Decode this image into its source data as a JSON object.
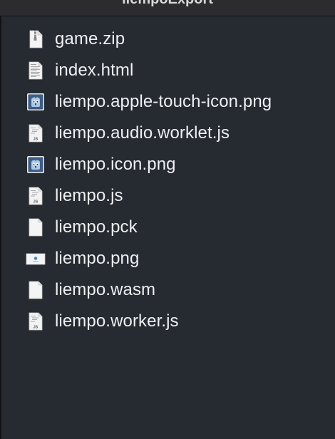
{
  "window": {
    "title": "liempoExport"
  },
  "files": [
    {
      "name": "game.zip",
      "icon": "zip-file-icon"
    },
    {
      "name": "index.html",
      "icon": "html-document-icon"
    },
    {
      "name": "liempo.apple-touch-icon.png",
      "icon": "godot-image-icon"
    },
    {
      "name": "liempo.audio.worklet.js",
      "icon": "js-file-icon"
    },
    {
      "name": "liempo.icon.png",
      "icon": "godot-image-icon"
    },
    {
      "name": "liempo.js",
      "icon": "js-file-icon"
    },
    {
      "name": "liempo.pck",
      "icon": "blank-document-icon"
    },
    {
      "name": "liempo.png",
      "icon": "image-preview-icon"
    },
    {
      "name": "liempo.wasm",
      "icon": "blank-document-icon"
    },
    {
      "name": "liempo.worker.js",
      "icon": "js-file-icon"
    }
  ],
  "colors": {
    "background": "#262a31",
    "text": "#eef0f3",
    "godot_blue": "#478cbf"
  }
}
